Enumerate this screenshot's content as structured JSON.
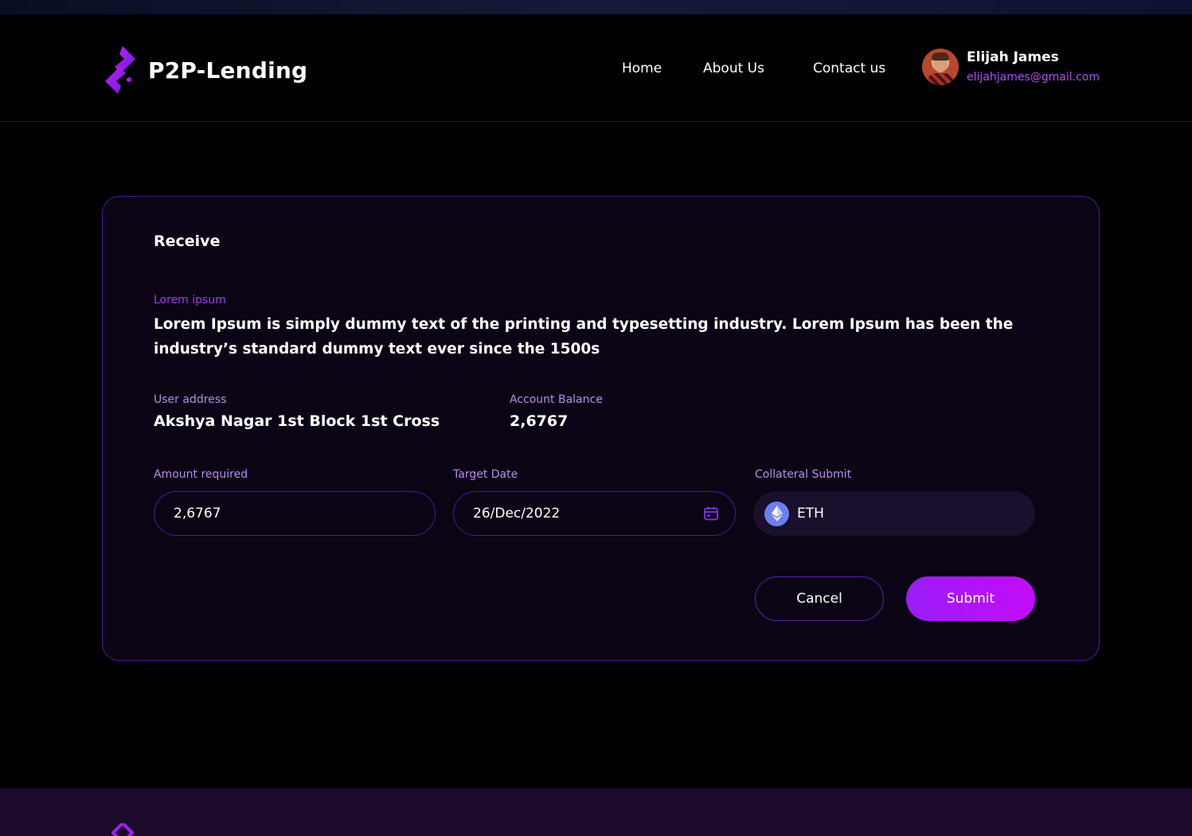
{
  "brand": {
    "name": "P2P-Lending",
    "logo_icon": "p2p-logo-icon",
    "accent": "#a21cf7"
  },
  "nav": {
    "home": "Home",
    "about": "About Us",
    "contact": "Contact us"
  },
  "user": {
    "name": "Elijah James",
    "email": "elijahjames@gmail.com"
  },
  "card": {
    "title": "Receive",
    "info_label": "Lorem ipsum",
    "description": "Lorem Ipsum is simply dummy text of the printing and typesetting industry. Lorem Ipsum has been the industry’s standard dummy text ever since the 1500s",
    "user_address_label": "User address",
    "user_address": "Akshya Nagar 1st Block 1st Cross",
    "balance_label": "Account Balance",
    "balance": "2,6767"
  },
  "form": {
    "amount_label": "Amount required",
    "amount_value": "2,6767",
    "date_label": "Target Date",
    "date_value": "26/Dec/2022",
    "collateral_label": "Collateral Submit",
    "collateral_value": "ETH",
    "cancel_label": "Cancel",
    "submit_label": "Submit"
  },
  "colors": {
    "border": "#4b17a0",
    "card_bg": "#0b0414",
    "footer_bg": "#1b0a2c",
    "label": "#b88aef"
  }
}
